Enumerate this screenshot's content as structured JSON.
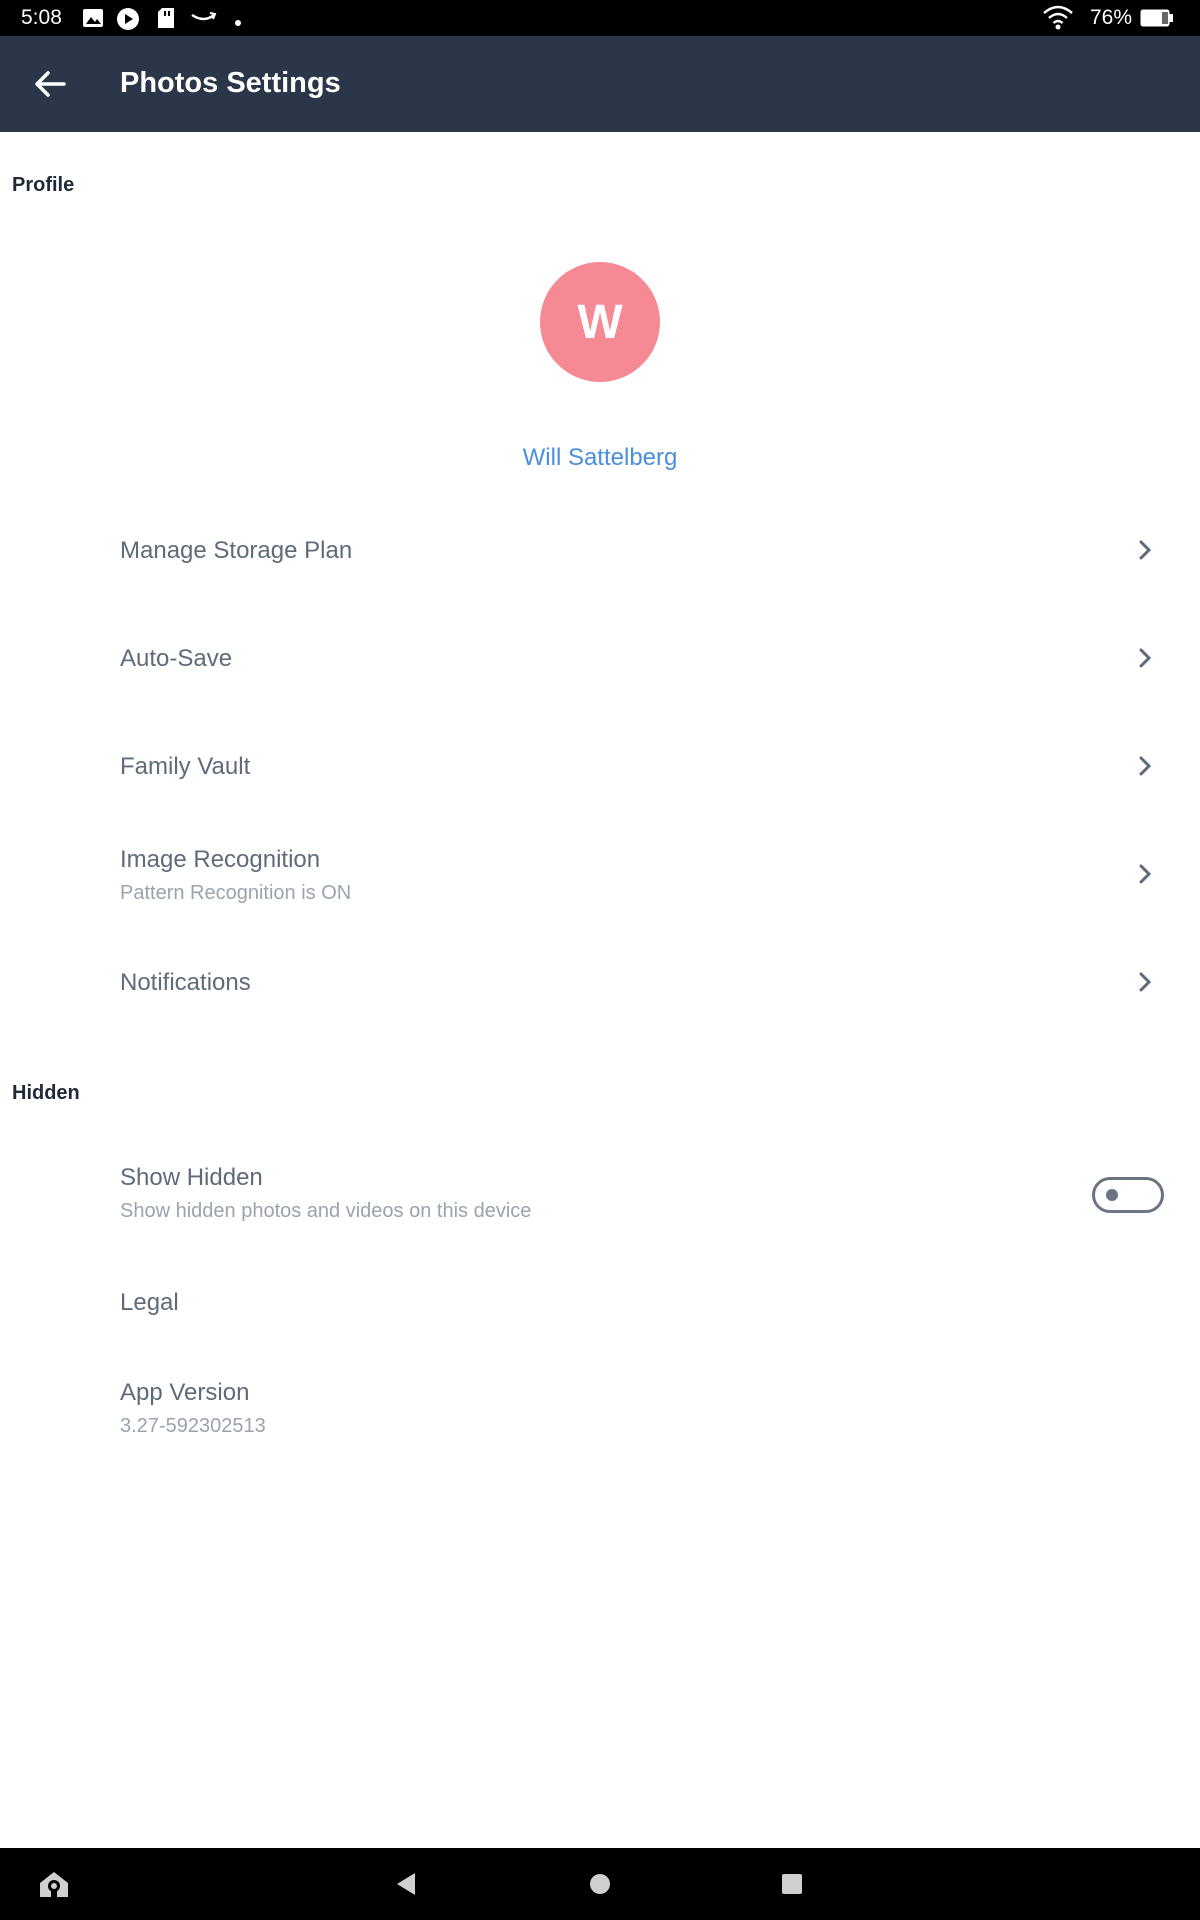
{
  "status_bar": {
    "time": "5:08",
    "battery": "76%",
    "icons": [
      "image-icon",
      "play-icon",
      "sd-card-icon",
      "amazon-smile-icon",
      "dot-icon",
      "wifi-icon",
      "battery-icon"
    ]
  },
  "header": {
    "back_icon": "arrow-left-icon",
    "title": "Photos Settings"
  },
  "profile": {
    "section_label": "Profile",
    "avatar_letter": "W",
    "avatar_color": "#f58a95",
    "name": "Will Sattelberg"
  },
  "settings": [
    {
      "title": "Manage Storage Plan"
    },
    {
      "title": "Auto-Save"
    },
    {
      "title": "Family Vault"
    },
    {
      "title": "Image Recognition",
      "subtitle": "Pattern Recognition is ON"
    },
    {
      "title": "Notifications"
    }
  ],
  "hidden": {
    "section_label": "Hidden",
    "show_hidden_title": "Show Hidden",
    "show_hidden_subtitle": "Show hidden photos and videos on this device",
    "show_hidden_on": false,
    "legal_title": "Legal",
    "app_version_title": "App Version",
    "app_version_value": "3.27-592302513"
  },
  "colors": {
    "app_bar": "#2b3648",
    "accent_link": "#4a8fdc"
  },
  "nav_bar": {
    "icons": [
      "alexa-home-icon",
      "back-triangle-icon",
      "home-circle-icon",
      "recents-square-icon"
    ]
  }
}
